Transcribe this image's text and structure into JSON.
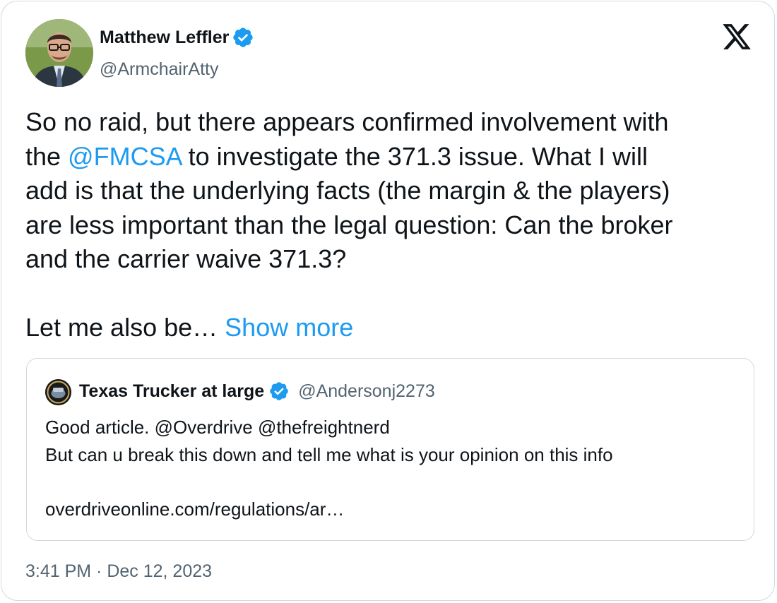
{
  "author": {
    "name": "Matthew Leffler",
    "handle": "@ArmchairAtty",
    "verified": true
  },
  "tweet": {
    "text_part1": "So no raid, but there appears confirmed involvement with\nthe ",
    "mention": "@FMCSA",
    "text_part2": " to investigate the 371.3 issue. What I will\nadd is that the underlying facts (the margin & the players)\nare less important than the legal question: Can the broker\nand the carrier waive 371.3?\n\nLet me also be… ",
    "show_more": "Show more"
  },
  "quote": {
    "name": "Texas Trucker at large",
    "handle": "@Andersonj2273",
    "verified": true,
    "text": "Good article. @Overdrive @thefreightnerd\nBut can u break this down and tell me what is your opinion on this info\n\noverdriveonline.com/regulations/ar…"
  },
  "timestamp": "3:41 PM · Dec 12, 2023",
  "colors": {
    "link": "#1d9bf0",
    "verified": "#1d9bf0",
    "secondary_text": "#536471",
    "border": "#cfd9de"
  },
  "icons": {
    "verified": "verified-badge-icon",
    "platform": "x-logo-icon"
  }
}
